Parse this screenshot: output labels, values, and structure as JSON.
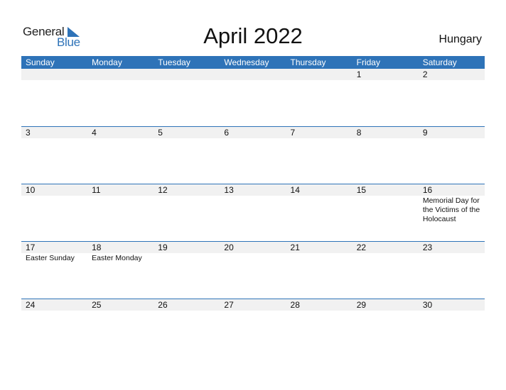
{
  "logo": {
    "word1": "General",
    "word2": "Blue"
  },
  "title": "April 2022",
  "country": "Hungary",
  "colors": {
    "accent": "#2e73b8",
    "stripe": "#f1f1f1"
  },
  "weekdays": [
    "Sunday",
    "Monday",
    "Tuesday",
    "Wednesday",
    "Thursday",
    "Friday",
    "Saturday"
  ],
  "weeks": [
    [
      {
        "d": ""
      },
      {
        "d": ""
      },
      {
        "d": ""
      },
      {
        "d": ""
      },
      {
        "d": ""
      },
      {
        "d": "1"
      },
      {
        "d": "2"
      }
    ],
    [
      {
        "d": "3"
      },
      {
        "d": "4"
      },
      {
        "d": "5"
      },
      {
        "d": "6"
      },
      {
        "d": "7"
      },
      {
        "d": "8"
      },
      {
        "d": "9"
      }
    ],
    [
      {
        "d": "10"
      },
      {
        "d": "11"
      },
      {
        "d": "12"
      },
      {
        "d": "13"
      },
      {
        "d": "14"
      },
      {
        "d": "15"
      },
      {
        "d": "16",
        "e": "Memorial Day for the Victims of the Holocaust"
      }
    ],
    [
      {
        "d": "17",
        "e": "Easter Sunday"
      },
      {
        "d": "18",
        "e": "Easter Monday"
      },
      {
        "d": "19"
      },
      {
        "d": "20"
      },
      {
        "d": "21"
      },
      {
        "d": "22"
      },
      {
        "d": "23"
      }
    ],
    [
      {
        "d": "24"
      },
      {
        "d": "25"
      },
      {
        "d": "26"
      },
      {
        "d": "27"
      },
      {
        "d": "28"
      },
      {
        "d": "29"
      },
      {
        "d": "30"
      }
    ]
  ]
}
